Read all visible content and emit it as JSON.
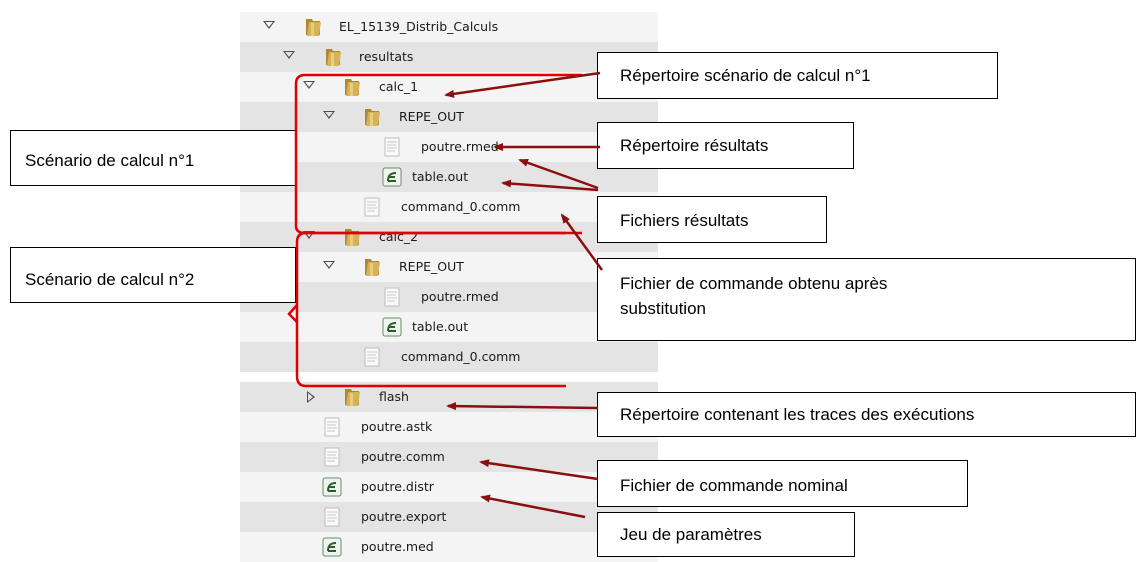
{
  "tree": {
    "rows": [
      {
        "label": "EL_15139_Distrib_Calculs",
        "icon": "folder-icon",
        "expander": "expanded"
      },
      {
        "label": "resultats",
        "icon": "folder-icon",
        "expander": "expanded"
      },
      {
        "label": "calc_1",
        "icon": "folder-icon",
        "expander": "expanded"
      },
      {
        "label": "REPE_OUT",
        "icon": "folder-icon",
        "expander": "expanded"
      },
      {
        "label": "poutre.rmed",
        "icon": "text-file-icon",
        "expander": "none"
      },
      {
        "label": "table.out",
        "icon": "table-file-icon",
        "expander": "none"
      },
      {
        "label": "command_0.comm",
        "icon": "text-file-icon",
        "expander": "none"
      },
      {
        "label": "calc_2",
        "icon": "folder-icon",
        "expander": "expanded"
      },
      {
        "label": "REPE_OUT",
        "icon": "folder-icon",
        "expander": "expanded"
      },
      {
        "label": "poutre.rmed",
        "icon": "text-file-icon",
        "expander": "none"
      },
      {
        "label": "table.out",
        "icon": "table-file-icon",
        "expander": "none"
      },
      {
        "label": "command_0.comm",
        "icon": "text-file-icon",
        "expander": "none"
      },
      {
        "label": "flash",
        "icon": "folder-icon",
        "expander": "collapsed"
      },
      {
        "label": "poutre.astk",
        "icon": "text-file-icon",
        "expander": "none"
      },
      {
        "label": "poutre.comm",
        "icon": "text-file-icon",
        "expander": "none"
      },
      {
        "label": "poutre.distr",
        "icon": "table-file-icon",
        "expander": "none"
      },
      {
        "label": "poutre.export",
        "icon": "text-file-icon",
        "expander": "none"
      },
      {
        "label": "poutre.med",
        "icon": "table-file-icon",
        "expander": "none"
      }
    ]
  },
  "callouts": {
    "scenario1": "Scénario de calcul n°1",
    "scenario2": "Scénario de calcul n°2",
    "rep_scenario": "Répertoire scénario de calcul n°1",
    "rep_resultats": "Répertoire résultats",
    "fichiers_resultats": "Fichiers résultats",
    "fichier_cmd_line1": "Fichier de commande obtenu après",
    "fichier_cmd_line2": "substitution",
    "rep_traces": "Répertoire contenant les traces des exécutions",
    "fichier_nominal": "Fichier de commande nominal",
    "jeu_parametres": "Jeu de paramètres"
  },
  "colors": {
    "arrow": "#8b0f0f",
    "bracket": "#e00000",
    "folder": "#c8a24a",
    "row_alt": "#e4e4e4",
    "row_plain": "#f4f4f4"
  }
}
